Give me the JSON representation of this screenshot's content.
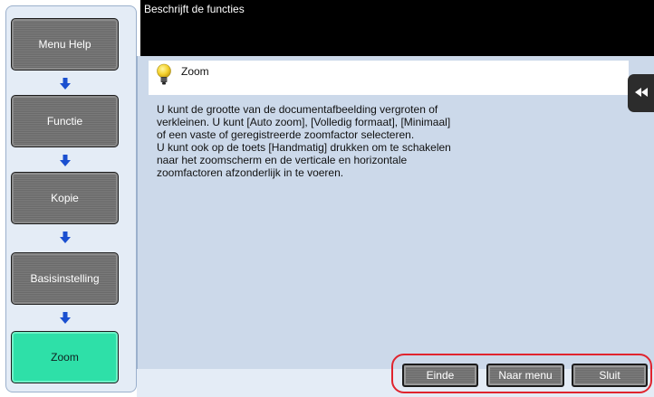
{
  "header": {
    "title": "Beschrijft de functies"
  },
  "nav": {
    "steps": [
      {
        "label": "Menu Help"
      },
      {
        "label": "Functie"
      },
      {
        "label": "Kopie"
      },
      {
        "label": "Basisinstelling"
      },
      {
        "label": "Zoom",
        "active": true
      }
    ]
  },
  "help": {
    "title": "Zoom",
    "icon": "lightbulb-icon",
    "lines": [
      "U kunt de grootte van de documentafbeelding vergroten of",
      "verkleinen. U kunt [Auto zoom], [Volledig formaat], [Minimaal]",
      "of een vaste of geregistreerde zoomfactor selecteren.",
      "U kunt ook op de toets [Handmatig] drukken om te schakelen",
      "naar het zoomscherm en de verticale en horizontale",
      "zoomfactoren afzonderlijk in te voeren."
    ]
  },
  "buttons": {
    "einde": "Einde",
    "naar_menu": "Naar menu",
    "sluit": "Sluit"
  },
  "colors": {
    "active_step": "#2ee0a8",
    "highlight": "#e0242e",
    "arrow": "#1a4fd0"
  }
}
